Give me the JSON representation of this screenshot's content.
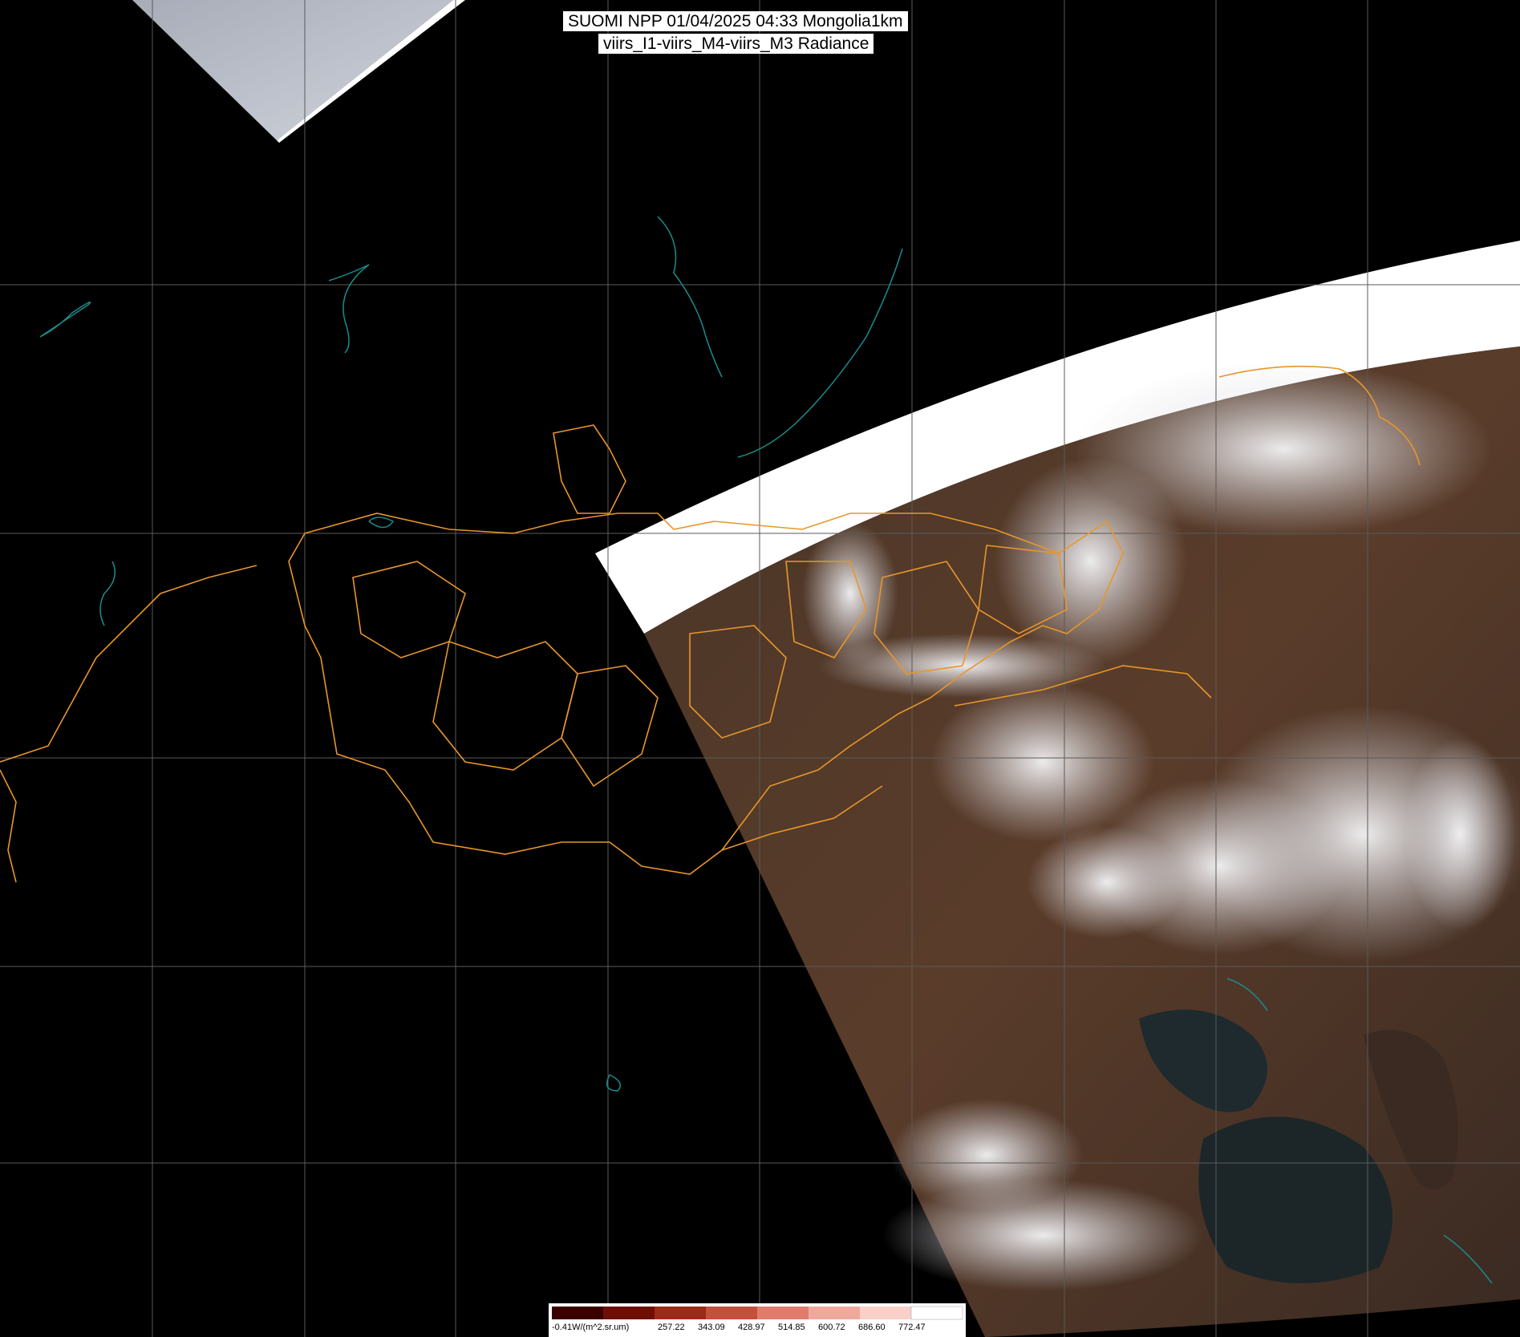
{
  "title": {
    "line1": "SUOMI NPP 01/04/2025 04:33 Mongolia1km",
    "line2": "viirs_I1-viirs_M4-viirs_M3 Radiance"
  },
  "legend": {
    "unit_label": "-0.41W/(m^2.sr.um)",
    "ticks": [
      "257.22",
      "343.09",
      "428.97",
      "514.85",
      "600.72",
      "686.60",
      "772.47"
    ],
    "colors": [
      "#3a0000",
      "#6e0f05",
      "#9c2a18",
      "#c4503c",
      "#e07c6c",
      "#f0a89c",
      "#f8d0c8",
      "#ffffff"
    ]
  },
  "colors": {
    "background": "#000000",
    "border_lines": "#e8962a",
    "water_lines": "#1a8c8c",
    "grid_lines": "#5a5a5a",
    "saturated_swath": "#ffffff"
  }
}
